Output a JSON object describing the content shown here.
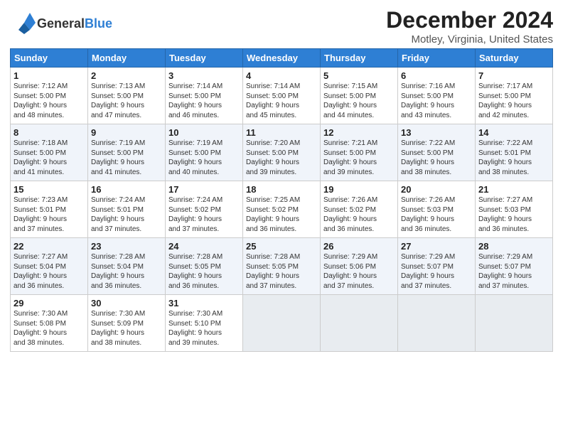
{
  "app": {
    "logo_general": "General",
    "logo_blue": "Blue",
    "title": "December 2024",
    "subtitle": "Motley, Virginia, United States"
  },
  "calendar": {
    "headers": [
      "Sunday",
      "Monday",
      "Tuesday",
      "Wednesday",
      "Thursday",
      "Friday",
      "Saturday"
    ],
    "weeks": [
      [
        {
          "day": "1",
          "info": "Sunrise: 7:12 AM\nSunset: 5:00 PM\nDaylight: 9 hours\nand 48 minutes."
        },
        {
          "day": "2",
          "info": "Sunrise: 7:13 AM\nSunset: 5:00 PM\nDaylight: 9 hours\nand 47 minutes."
        },
        {
          "day": "3",
          "info": "Sunrise: 7:14 AM\nSunset: 5:00 PM\nDaylight: 9 hours\nand 46 minutes."
        },
        {
          "day": "4",
          "info": "Sunrise: 7:14 AM\nSunset: 5:00 PM\nDaylight: 9 hours\nand 45 minutes."
        },
        {
          "day": "5",
          "info": "Sunrise: 7:15 AM\nSunset: 5:00 PM\nDaylight: 9 hours\nand 44 minutes."
        },
        {
          "day": "6",
          "info": "Sunrise: 7:16 AM\nSunset: 5:00 PM\nDaylight: 9 hours\nand 43 minutes."
        },
        {
          "day": "7",
          "info": "Sunrise: 7:17 AM\nSunset: 5:00 PM\nDaylight: 9 hours\nand 42 minutes."
        }
      ],
      [
        {
          "day": "8",
          "info": "Sunrise: 7:18 AM\nSunset: 5:00 PM\nDaylight: 9 hours\nand 41 minutes."
        },
        {
          "day": "9",
          "info": "Sunrise: 7:19 AM\nSunset: 5:00 PM\nDaylight: 9 hours\nand 41 minutes."
        },
        {
          "day": "10",
          "info": "Sunrise: 7:19 AM\nSunset: 5:00 PM\nDaylight: 9 hours\nand 40 minutes."
        },
        {
          "day": "11",
          "info": "Sunrise: 7:20 AM\nSunset: 5:00 PM\nDaylight: 9 hours\nand 39 minutes."
        },
        {
          "day": "12",
          "info": "Sunrise: 7:21 AM\nSunset: 5:00 PM\nDaylight: 9 hours\nand 39 minutes."
        },
        {
          "day": "13",
          "info": "Sunrise: 7:22 AM\nSunset: 5:00 PM\nDaylight: 9 hours\nand 38 minutes."
        },
        {
          "day": "14",
          "info": "Sunrise: 7:22 AM\nSunset: 5:01 PM\nDaylight: 9 hours\nand 38 minutes."
        }
      ],
      [
        {
          "day": "15",
          "info": "Sunrise: 7:23 AM\nSunset: 5:01 PM\nDaylight: 9 hours\nand 37 minutes."
        },
        {
          "day": "16",
          "info": "Sunrise: 7:24 AM\nSunset: 5:01 PM\nDaylight: 9 hours\nand 37 minutes."
        },
        {
          "day": "17",
          "info": "Sunrise: 7:24 AM\nSunset: 5:02 PM\nDaylight: 9 hours\nand 37 minutes."
        },
        {
          "day": "18",
          "info": "Sunrise: 7:25 AM\nSunset: 5:02 PM\nDaylight: 9 hours\nand 36 minutes."
        },
        {
          "day": "19",
          "info": "Sunrise: 7:26 AM\nSunset: 5:02 PM\nDaylight: 9 hours\nand 36 minutes."
        },
        {
          "day": "20",
          "info": "Sunrise: 7:26 AM\nSunset: 5:03 PM\nDaylight: 9 hours\nand 36 minutes."
        },
        {
          "day": "21",
          "info": "Sunrise: 7:27 AM\nSunset: 5:03 PM\nDaylight: 9 hours\nand 36 minutes."
        }
      ],
      [
        {
          "day": "22",
          "info": "Sunrise: 7:27 AM\nSunset: 5:04 PM\nDaylight: 9 hours\nand 36 minutes."
        },
        {
          "day": "23",
          "info": "Sunrise: 7:28 AM\nSunset: 5:04 PM\nDaylight: 9 hours\nand 36 minutes."
        },
        {
          "day": "24",
          "info": "Sunrise: 7:28 AM\nSunset: 5:05 PM\nDaylight: 9 hours\nand 36 minutes."
        },
        {
          "day": "25",
          "info": "Sunrise: 7:28 AM\nSunset: 5:05 PM\nDaylight: 9 hours\nand 37 minutes."
        },
        {
          "day": "26",
          "info": "Sunrise: 7:29 AM\nSunset: 5:06 PM\nDaylight: 9 hours\nand 37 minutes."
        },
        {
          "day": "27",
          "info": "Sunrise: 7:29 AM\nSunset: 5:07 PM\nDaylight: 9 hours\nand 37 minutes."
        },
        {
          "day": "28",
          "info": "Sunrise: 7:29 AM\nSunset: 5:07 PM\nDaylight: 9 hours\nand 37 minutes."
        }
      ],
      [
        {
          "day": "29",
          "info": "Sunrise: 7:30 AM\nSunset: 5:08 PM\nDaylight: 9 hours\nand 38 minutes."
        },
        {
          "day": "30",
          "info": "Sunrise: 7:30 AM\nSunset: 5:09 PM\nDaylight: 9 hours\nand 38 minutes."
        },
        {
          "day": "31",
          "info": "Sunrise: 7:30 AM\nSunset: 5:10 PM\nDaylight: 9 hours\nand 39 minutes."
        },
        {
          "day": "",
          "info": ""
        },
        {
          "day": "",
          "info": ""
        },
        {
          "day": "",
          "info": ""
        },
        {
          "day": "",
          "info": ""
        }
      ]
    ]
  }
}
